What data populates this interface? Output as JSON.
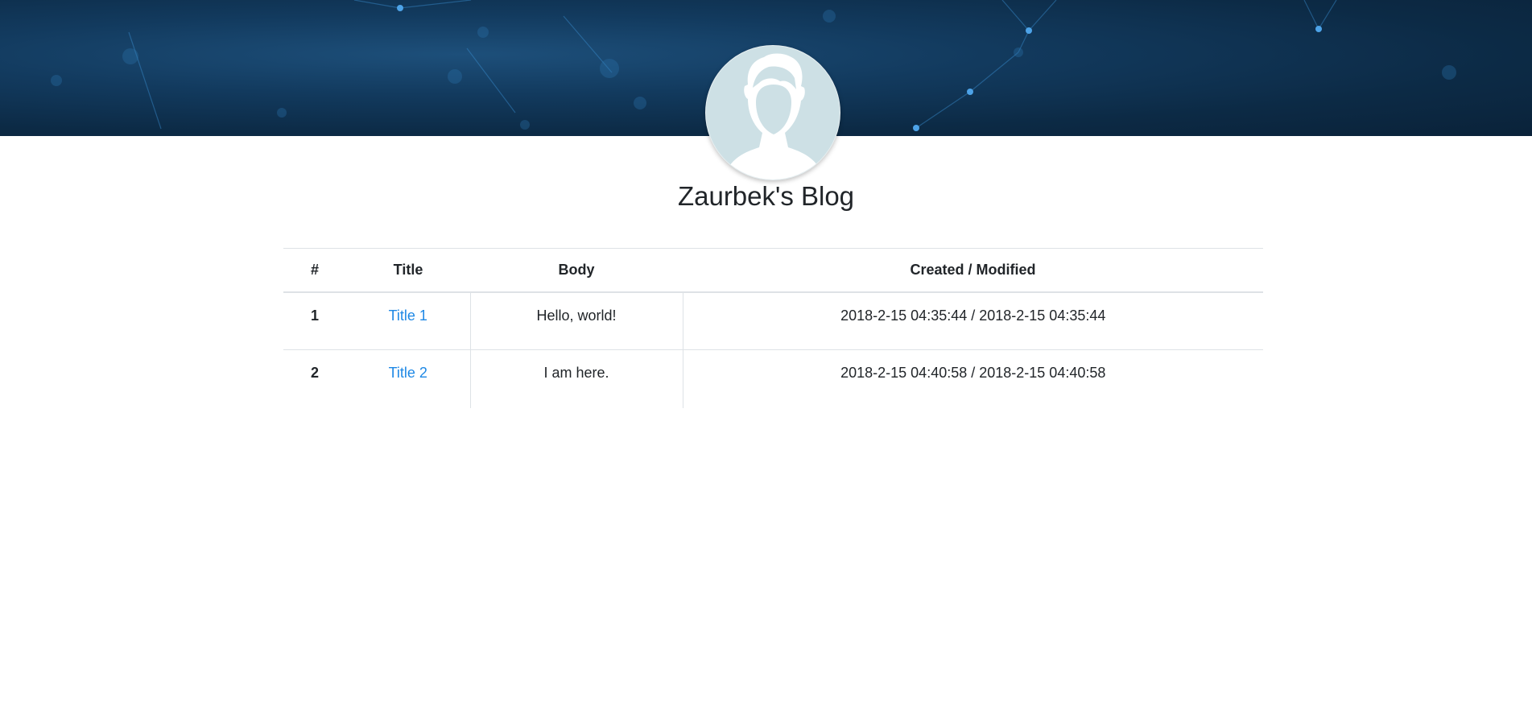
{
  "header": {
    "banner_colors": [
      "#0c2a45",
      "#1d4f7a"
    ],
    "avatar_bg": "#cde0e5",
    "blog_title": "Zaurbek's Blog"
  },
  "table": {
    "columns": [
      "#",
      "Title",
      "Body",
      "Created / Modified"
    ],
    "rows": [
      {
        "num": "1",
        "title": "Title 1",
        "body": "Hello, world!",
        "dates": "2018-2-15 04:35:44 / 2018-2-15 04:35:44"
      },
      {
        "num": "2",
        "title": "Title 2",
        "body": "I am here.",
        "dates": "2018-2-15 04:40:58 / 2018-2-15 04:40:58"
      }
    ],
    "link_color": "#1e88e5"
  }
}
